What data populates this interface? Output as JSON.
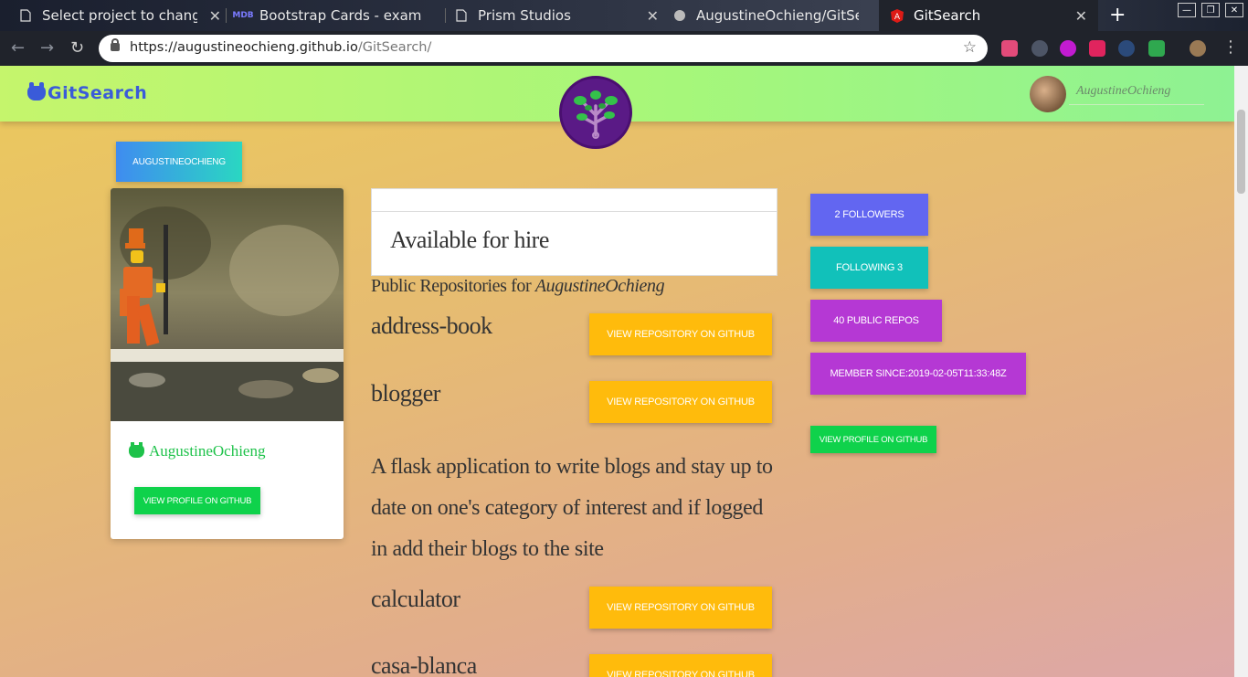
{
  "browser": {
    "tabs": [
      {
        "label": "Select project to change |"
      },
      {
        "label": "Bootstrap Cards - exampl"
      },
      {
        "label": "Prism Studios"
      },
      {
        "label": "AugustineOchieng/GitSe"
      },
      {
        "label": "GitSearch"
      }
    ],
    "new_tab": "+",
    "url_host": "https://augustineochieng.github.io",
    "url_path": "/GitSearch/"
  },
  "navbar": {
    "brand": "GitSearch",
    "username": "AugustineOchieng"
  },
  "sidebar": {
    "username_chip": "AugustineOchieng",
    "card_name": "AugustineOchieng",
    "view_profile": "View Profile on GitHub"
  },
  "main": {
    "hire_status": "Available for hire",
    "repos_heading_prefix": "Public Repositories for",
    "repos_heading_user": "AugustineOchieng",
    "view_repo_label": "View Repository on GitHub",
    "repos": [
      {
        "name": "address-book",
        "description": ""
      },
      {
        "name": "blogger",
        "description": "A flask application to write blogs and stay up to date on one's category of interest and if logged in add their blogs to the site"
      },
      {
        "name": "calculator",
        "description": ""
      },
      {
        "name": "casa-blanca",
        "description": ""
      }
    ]
  },
  "stats": {
    "followers": "2 Followers",
    "following": "Following 3",
    "public_repos": "40 Public Repos",
    "member_since": "Member Since:2019-02-05T11:33:48Z",
    "view_profile": "View Profile on GitHub"
  },
  "colors": {
    "brand_blue": "#3a5bd9",
    "github_green": "#0fd24b",
    "repo_button_yellow": "#ffbb0c",
    "followers_blue": "#6266f1",
    "following_teal": "#11c1ba",
    "repos_purple": "#b538d4"
  }
}
